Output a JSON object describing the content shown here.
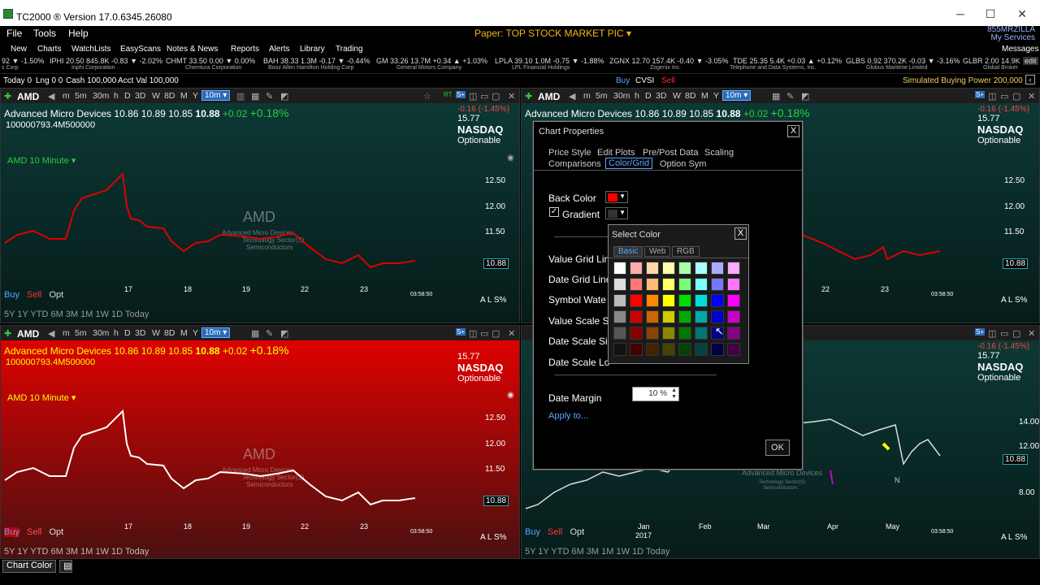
{
  "window": {
    "title": "TC2000 ® Version 17.0.6345.26080",
    "minimize": "─",
    "maximize": "☐",
    "close": "✕"
  },
  "menu": {
    "file": "File",
    "tools": "Tools",
    "help": "Help"
  },
  "paper": "Paper: TOP STOCK MARKET PIC ▾",
  "user": {
    "name": "855MRZILLA",
    "services": "My Services",
    "messages": "Messages"
  },
  "toolbar": [
    "New",
    "Charts",
    "WatchLists",
    "EasyScans",
    "Notes & News",
    "Reports",
    "Alerts",
    "Library",
    "Trading"
  ],
  "ticker": [
    {
      "text": "92 ▼ -1.50%",
      "sub": "s Corp"
    },
    {
      "text": "IPHI 20.50 845.8K -0.83 ▼ -2.02%",
      "sub": "Inphi Corporation"
    },
    {
      "text": "CHMT 33.50 0.00 ▼ 0.00%",
      "sub": "Chemtura Corporation"
    },
    {
      "text": "BAH 38.33 1.3M -0.17 ▼ -0.44%",
      "sub": "Booz Allen Hamilton Holding Corp"
    },
    {
      "text": "GM 33.26 13.7M +0.34 ▲ +1.03%",
      "sub": "General Motors Company"
    },
    {
      "text": "LPLA 39.10 1.0M -0.75 ▼ -1.88%",
      "sub": "LPL Financial Holdings"
    },
    {
      "text": "ZGNX 12.70 157.4K -0.40 ▼ -3.05%",
      "sub": "Zogenix Inc."
    },
    {
      "text": "TDE 25.35 5.4K +0.03 ▲ +0.12%",
      "sub": "Telephone and Data Systems, Inc."
    },
    {
      "text": "GLBS 0.92 370.2K -0.03 ▼ -3.16%",
      "sub": "Globus Maritime Limited"
    },
    {
      "text": "GLBR 2.00 14.9K",
      "sub": "Global Broker"
    },
    {
      "text": "edit",
      "sub": ""
    }
  ],
  "account": {
    "today": "Today 0",
    "lng": "Lng 0 0",
    "cash": "Cash 100,000",
    "acct": "Acct Val 100,000",
    "buy": "Buy",
    "sym": "CVSI",
    "sell": "Sell",
    "bp": "Simulated Buying Power 200,000"
  },
  "chart": {
    "symbol": "AMD",
    "tools": [
      "m",
      "5m",
      "30m",
      "h",
      "D",
      "3D",
      "W",
      "8D",
      "M",
      "Y"
    ],
    "timeframe": "10m ▾",
    "company": "Advanced Micro Devices",
    "ohlc": "10.86  10.89  10.85",
    "last": "10.88",
    "change": "+0.02",
    "pct": "+0.18%",
    "volume": "100000793.4M500000",
    "change_red": "-0.16 (-1.45%)",
    "high52": "15.77",
    "exchange": "NASDAQ",
    "optionable": "Optionable",
    "tf_label": "AMD 10 Minute ▾",
    "wm_sym": "AMD",
    "wm_company": "Advanced Micro Devices",
    "wm_sector": "Technology Sector(S)",
    "wm_industry": "Semiconductors",
    "prices": [
      "12.50",
      "12.00",
      "11.50"
    ],
    "tag": "10.88",
    "xlabels": [
      "17",
      "18",
      "19",
      "22",
      "23"
    ],
    "time": "03:58:50",
    "buy": "Buy",
    "sell": "Sell",
    "opt": "Opt",
    "scale": "A L S%",
    "periods": "5Y  1Y  YTD  6M  3M  1M  1W  1D  Today",
    "bid": "10.89",
    "ask": "10.88",
    "daily_prices": [
      "14.00",
      "12.00",
      "10.88",
      "8.00"
    ],
    "daily_x": [
      "Jan",
      "2017",
      "Feb",
      "Mar",
      "Apr",
      "May"
    ],
    "marker_n": "N",
    "x_series": [
      {
        "name": "",
        "values": [
          0,
          1,
          2,
          3,
          4,
          5
        ]
      }
    ]
  },
  "dialog": {
    "title": "Chart Properties",
    "close": "X",
    "tabs_row1": [
      "Price Style",
      "Edit Plots",
      "Pre/Post Data",
      "Scaling"
    ],
    "tabs_row2": [
      "Comparisons",
      "Color/Grid",
      "Option Sym"
    ],
    "back_color": "Back Color",
    "gradient": "Gradient",
    "value_grid": "Value Grid Lin",
    "date_grid": "Date Grid Line",
    "symbol_wm": "Symbol Wate",
    "value_scale": "Value Scale Si",
    "date_scale_size": "Date Scale Siz",
    "date_scale_loc": "Date Scale Lo",
    "date_margin": "Date Margin",
    "date_margin_val": "10 %",
    "apply": "Apply to...",
    "ok": "OK",
    "back_color_hex": "#ff0000",
    "gradient_hex": "#333333"
  },
  "select_color": {
    "title": "Select Color",
    "close": "X",
    "tabs": [
      "Basic",
      "Web",
      "RGB"
    ],
    "palette": [
      [
        "#ffffff",
        "#ffaaaa",
        "#ffd6aa",
        "#ffffaa",
        "#aaffaa",
        "#aaffff",
        "#aaaaff",
        "#ffaaff"
      ],
      [
        "#dddddd",
        "#ff7777",
        "#ffbb77",
        "#ffff66",
        "#77ff77",
        "#77ffff",
        "#7777ff",
        "#ff77ff"
      ],
      [
        "#bbbbbb",
        "#ff0000",
        "#ff8800",
        "#ffff00",
        "#00dd00",
        "#00dddd",
        "#0000ff",
        "#ff00ff"
      ],
      [
        "#888888",
        "#cc0000",
        "#cc6600",
        "#cccc00",
        "#00aa00",
        "#00aaaa",
        "#0000cc",
        "#cc00cc"
      ],
      [
        "#555555",
        "#880000",
        "#884400",
        "#888800",
        "#007700",
        "#007777",
        "#000088",
        "#880088"
      ],
      [
        "#111111",
        "#440000",
        "#442200",
        "#444400",
        "#004400",
        "#004444",
        "#000044",
        "#440044"
      ]
    ]
  },
  "bottom_tab": "Chart Color"
}
